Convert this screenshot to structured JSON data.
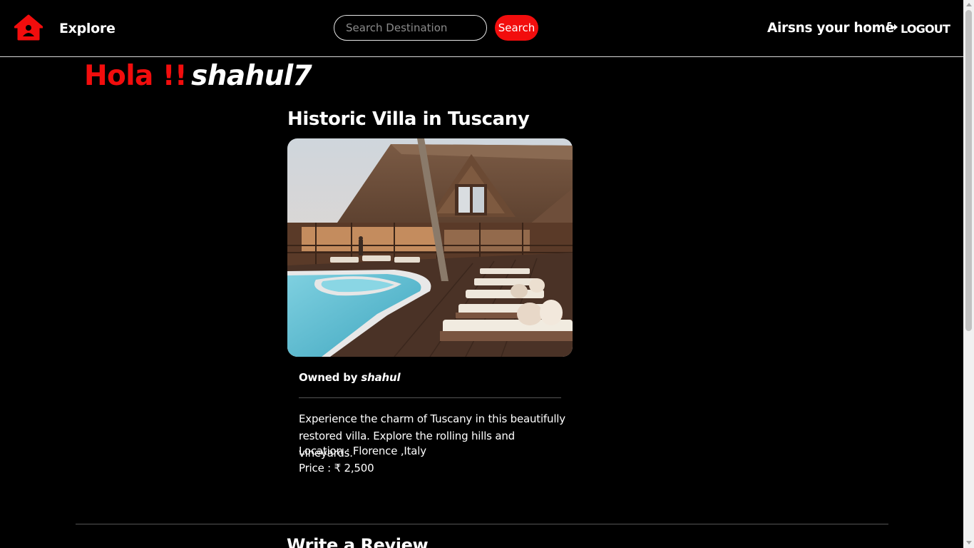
{
  "navbar": {
    "logo_icon": "house-icon",
    "explore_label": "Explore",
    "search_placeholder": "Search Destination",
    "search_value": "",
    "search_button_label": "Search",
    "host_link_label": "Airsns your home",
    "logout_icon": "logout-arrow-icon",
    "logout_label": "LOGOUT"
  },
  "greeting": {
    "prefix": "Hola !!",
    "username": "shahul7"
  },
  "listing": {
    "title": "Historic Villa in Tuscany",
    "image_icon": "listing-photo",
    "owner_prefix": "Owned by",
    "owner_name": "shahul",
    "description": "Experience the charm of Tuscany in this beautifully restored villa. Explore the rolling hills and vineyards.",
    "location": "Location : Florence ,Italy",
    "price": "Price : ₹ 2,500"
  },
  "review": {
    "heading": "Write a Review"
  },
  "colors": {
    "accent": "#f20d0d",
    "background": "#000000",
    "text": "#ffffff"
  }
}
